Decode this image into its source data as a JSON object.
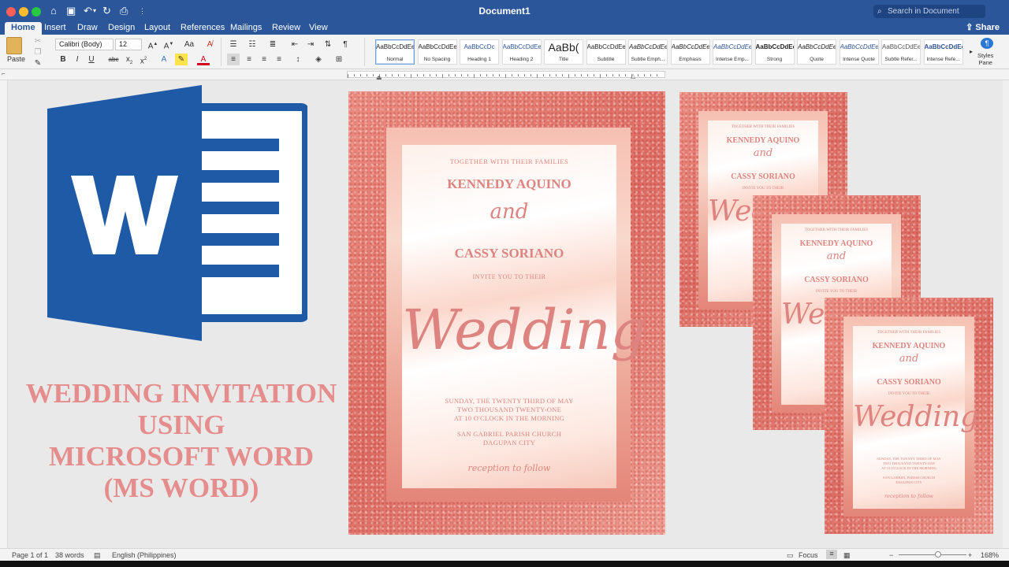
{
  "window": {
    "title": "Document1",
    "search_placeholder": "Search in Document",
    "share_label": "Share"
  },
  "tabs": [
    "Home",
    "Insert",
    "Draw",
    "Design",
    "Layout",
    "References",
    "Mailings",
    "Review",
    "View"
  ],
  "ribbon": {
    "paste_label": "Paste",
    "font_name": "Calibri (Body)",
    "font_size": "12",
    "styles": [
      {
        "preview": "AaBbCcDdEe",
        "name": "Normal"
      },
      {
        "preview": "AaBbCcDdEe",
        "name": "No Spacing"
      },
      {
        "preview": "AaBbCcDc",
        "name": "Heading 1"
      },
      {
        "preview": "AaBbCcDdEe",
        "name": "Heading 2"
      },
      {
        "preview": "AaBb(",
        "name": "Title"
      },
      {
        "preview": "AaBbCcDdEe",
        "name": "Subtitle"
      },
      {
        "preview": "AaBbCcDdEe",
        "name": "Subtle Emph..."
      },
      {
        "preview": "AaBbCcDdEe",
        "name": "Emphasis"
      },
      {
        "preview": "AaBbCcDdEe",
        "name": "Intense Emp..."
      },
      {
        "preview": "AaBbCcDdEe",
        "name": "Strong"
      },
      {
        "preview": "AaBbCcDdEe",
        "name": "Quote"
      },
      {
        "preview": "AaBbCcDdEe",
        "name": "Intense Quote"
      },
      {
        "preview": "AaBbCcDdEe",
        "name": "Subtle Refer..."
      },
      {
        "preview": "AaBbCcDdEe",
        "name": "Intense Refe..."
      }
    ],
    "styles_pane_label": "Styles\nPane"
  },
  "thumbnail_title": "WEDDING INVITATION\nUSING\nMICROSOFT WORD\n(MS WORD)",
  "invitation": {
    "together": "TOGETHER WITH THEIR FAMILIES",
    "name1": "KENNEDY AQUINO",
    "and": "and",
    "name2": "CASSY SORIANO",
    "invite": "INVITE YOU TO THEIR",
    "wedding": "Wedding",
    "date_line1": "SUNDAY, THE TWENTY THIRD OF MAY",
    "date_line2": "TWO THOUSAND TWENTY-ONE",
    "date_line3": "AT 10 O'CLOCK IN THE MORNING",
    "venue1": "SAN GABRIEL PARISH CHURCH",
    "venue2": "DAGUPAN CITY",
    "reception": "reception to follow"
  },
  "status": {
    "page": "Page 1 of 1",
    "words": "38 words",
    "language": "English (Philippines)",
    "focus": "Focus",
    "zoom": "168%"
  },
  "colors": {
    "word_blue": "#2b579a",
    "rose": "#e58c8c"
  }
}
